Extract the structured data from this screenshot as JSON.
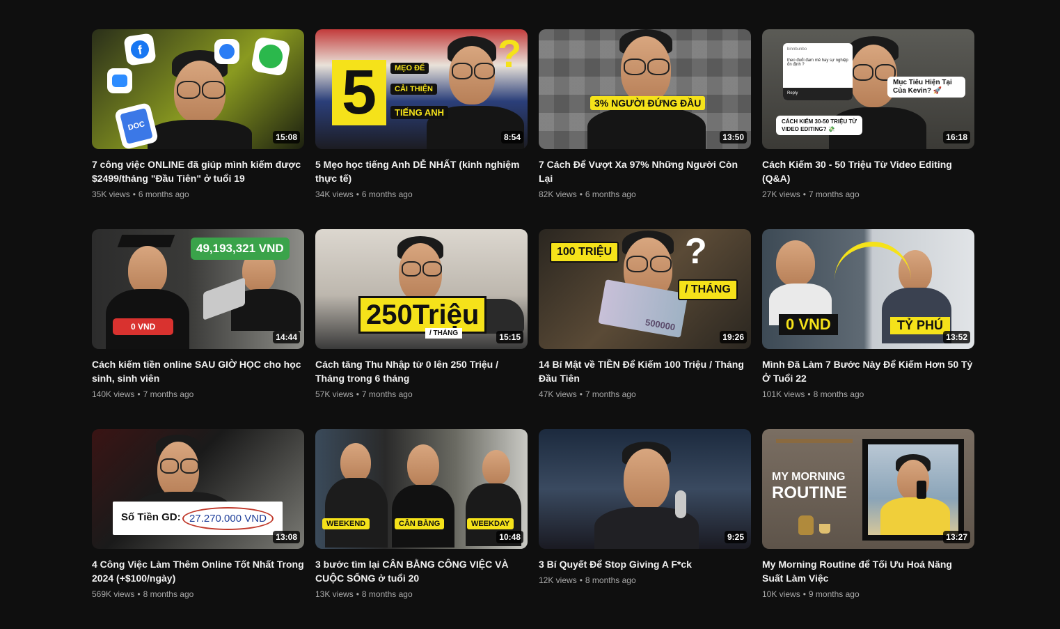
{
  "videos": [
    {
      "title": "7 công việc ONLINE đã giúp mình kiếm được $2499/tháng \"Đầu Tiên\" ở tuổi 19",
      "views": "35K views",
      "age": "6 months ago",
      "duration": "15:08",
      "thumb_bg": "linear-gradient(135deg,#2a2f1a 0%,#8a9a20 55%,#1c2010 100%)",
      "thumb_text": [
        "DOC"
      ]
    },
    {
      "title": "5 Mẹo học tiếng Anh DỄ NHẤT (kinh nghiệm thực tế)",
      "views": "34K views",
      "age": "6 months ago",
      "duration": "8:54",
      "thumb_bg": "linear-gradient(180deg,#c23b3b 0%,#e9e2d9 30%,#2b3f7a 60%,#1c1c22 100%)",
      "thumb_text": [
        "5",
        "MẸO ĐỂ",
        "CẢI THIỆN",
        "TIẾNG ANH",
        "?"
      ]
    },
    {
      "title": "7 Cách Để Vượt Xa 97% Những Người Còn Lại",
      "views": "82K views",
      "age": "6 months ago",
      "duration": "13:50",
      "thumb_bg": "linear-gradient(180deg,#8c8c8c 0%,#6d6d6d 50%,#4a4a4a 100%)",
      "thumb_text": [
        "3% NGƯỜI ĐỨNG ĐẦU"
      ]
    },
    {
      "title": "Cách Kiếm 30 - 50 Triệu Từ Video Editing (Q&A)",
      "views": "27K views",
      "age": "7 months ago",
      "duration": "16:18",
      "thumb_bg": "linear-gradient(180deg,#5b5b56 0%,#3b3a36 100%)",
      "thumb_text": [
        "binnbunbo",
        "theo đuổi đam mê hay sự nghiệp ổn định ?",
        "Reply",
        "Mục Tiêu Hiện Tại Của Kevin? 🚀",
        "CÁCH KIẾM 30-50 TRIỆU TỪ VIDEO EDITING? 💸"
      ]
    },
    {
      "title": "Cách kiếm tiền online SAU GIỜ HỌC cho học sinh, sinh viên",
      "views": "140K views",
      "age": "7 months ago",
      "duration": "14:44",
      "thumb_bg": "linear-gradient(135deg,#2c2c2c 0%,#4a4a48 50%,#8d8d88 100%)",
      "thumb_text": [
        "49,193,321 VND",
        "0 VND"
      ]
    },
    {
      "title": "Cách tăng Thu Nhập từ 0 lên 250 Triệu / Tháng trong 6 tháng",
      "views": "57K views",
      "age": "7 months ago",
      "duration": "15:15",
      "thumb_bg": "linear-gradient(180deg,#d9d4cc 0%,#b9b3aa 55%,#3a3a3a 100%)",
      "thumb_text": [
        "250Triệu",
        "/ THÁNG"
      ]
    },
    {
      "title": "14 Bí Mật về TIỀN Để Kiếm 100 Triệu / Tháng Đầu Tiên",
      "views": "47K views",
      "age": "7 months ago",
      "duration": "19:26",
      "thumb_bg": "linear-gradient(135deg,#2a2620 0%,#5a4a36 50%,#2a2620 100%)",
      "thumb_text": [
        "100 TRIỆU",
        "/ THÁNG",
        "?",
        "500000"
      ]
    },
    {
      "title": "Mình Đã Làm 7 Bước Này Để Kiếm Hơn 50 Tỷ Ở Tuổi 22",
      "views": "101K views",
      "age": "8 months ago",
      "duration": "13:52",
      "thumb_bg": "linear-gradient(90deg,#3d4a55 0%,#6a7580 50%,#c7ccd1 100%)",
      "thumb_text": [
        "0 VND",
        "TỶ PHÚ"
      ]
    },
    {
      "title": "4 Công Việc Làm Thêm Online Tốt Nhất Trong 2024 (+$100/ngày)",
      "views": "569K views",
      "age": "8 months ago",
      "duration": "13:08",
      "thumb_bg": "linear-gradient(135deg,#3a1414 0%,#1a1a1a 40%,#7a7a74 100%)",
      "thumb_text": [
        "Số Tiền GD:",
        "27.270.000 VND"
      ]
    },
    {
      "title": "3 bước tìm lại CÂN BẰNG CÔNG VIỆC VÀ CUỘC SỐNG ở tuổi 20",
      "views": "13K views",
      "age": "8 months ago",
      "duration": "10:48",
      "thumb_bg": "linear-gradient(90deg,#3a4a5a 0%,#2a2a2a 33%,#6a6a62 66%,#c9c9c4 100%)",
      "thumb_text": [
        "WEEKEND",
        "CÂN BẰNG",
        "WEEKDAY"
      ]
    },
    {
      "title": "3 Bí Quyết Để Stop Giving A F*ck",
      "views": "12K views",
      "age": "8 months ago",
      "duration": "9:25",
      "thumb_bg": "linear-gradient(180deg,#1c2a3e 0%,#3a4a60 50%,#1a1a22 100%)",
      "thumb_text": []
    },
    {
      "title": "My Morning Routine để Tối Ưu Hoá Năng Suất Làm Việc",
      "views": "10K views",
      "age": "9 months ago",
      "duration": "13:27",
      "thumb_bg": "linear-gradient(180deg,#7a6e62 0%,#5e544a 100%)",
      "thumb_text": [
        "MY MORNING",
        "ROUTINE"
      ]
    }
  ],
  "separator": "•"
}
